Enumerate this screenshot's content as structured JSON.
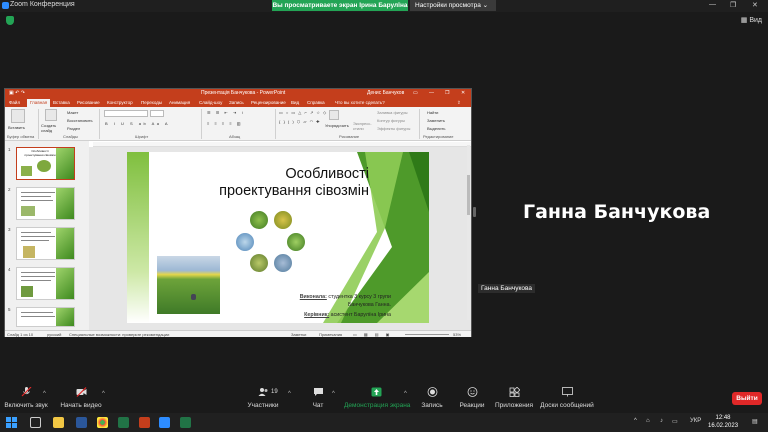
{
  "zoom": {
    "window_title": "Zoom Конференция",
    "share_banner": "Вы просматриваете экран Ірина Барулїна",
    "view_settings": "Настройки просмотра",
    "view_button": "Вид",
    "window_controls": [
      "—",
      "❐",
      "✕"
    ]
  },
  "powerpoint": {
    "window_title": "Презентація Банчукова - PowerPoint",
    "user": "Денис Банчуков",
    "title_controls": [
      "▭",
      "—",
      "❐",
      "✕"
    ],
    "tabs": [
      "Файл",
      "Главная",
      "Вставка",
      "Рисование",
      "Конструктор",
      "Переходы",
      "Анимация",
      "Слайд-шоу",
      "Запись",
      "Рецензирование",
      "Вид",
      "Справка",
      "Что вы хотите сделать?"
    ],
    "active_tab": "Главная",
    "ribbon": {
      "paste": "Вставить",
      "clipboard": "Буфер обмена",
      "new_slide": "Создать слайд",
      "layout": "Макет",
      "reset": "Восстановить",
      "section": "Раздел",
      "slides": "Слайды",
      "font": "Шрифт",
      "paragraph": "Абзац",
      "arrange": "Упорядочить",
      "quick_styles": "Экспресс-стили",
      "drawing": "Рисование",
      "shape_fill": "Заливка фигуры",
      "shape_outline": "Контур фигуры",
      "shape_effects": "Эффекты фигуры",
      "find": "Найти",
      "replace": "Заменить",
      "select": "Выделить",
      "editing": "Редактирование"
    },
    "thumb_numbers": [
      "1",
      "2",
      "3",
      "4",
      "5"
    ],
    "thumb1_title": "Особливості проектування сівозмін",
    "slide": {
      "title_line1": "Особливості",
      "title_line2": "проектування сівозмін",
      "performed_label": "Виконала:",
      "performed_text": "студентка 3 курсу 3 групи",
      "performed_name": "Банчукова  Ганна.",
      "supervisor_label": "Керівник:",
      "supervisor_text": "асистент Барулїна Ірина"
    },
    "status": {
      "slide_info": "Слайд 1 из 10",
      "language": "русский",
      "accessibility": "Специальные возможности: проверьте рекомендации",
      "notes": "Заметки",
      "comments": "Примечания",
      "zoom": "53%"
    }
  },
  "participant": {
    "big_name": "Ганна Банчукова",
    "small_name": "Ганна Банчукова"
  },
  "toolbar": {
    "unmute": "Включить звук",
    "start_video": "Начать видео",
    "participants": "Участники",
    "participants_count": "19",
    "chat": "Чат",
    "share": "Демонстрация экрана",
    "record": "Запись",
    "reactions": "Реакции",
    "apps": "Приложения",
    "whiteboards": "Доски сообщений",
    "leave": "Выйти"
  },
  "taskbar": {
    "lang": "УКР",
    "time": "12:48",
    "date": "16.02.2023"
  },
  "colors": {
    "zoom_green": "#23a455",
    "ppt_red": "#c43e1c",
    "leave_red": "#e02828"
  }
}
